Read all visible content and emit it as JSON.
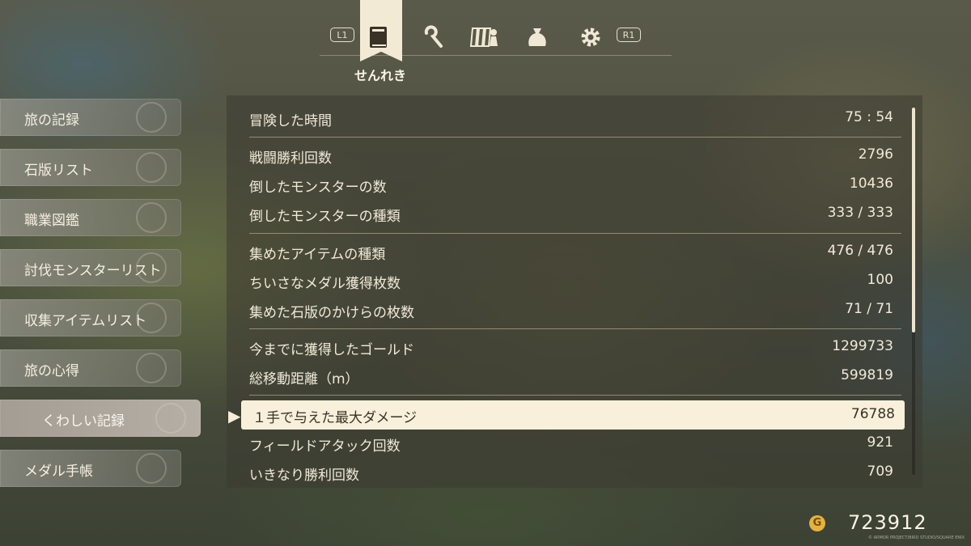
{
  "topnav": {
    "l_button": "L1",
    "r_button": "R1",
    "active_tab_label": "せんれき",
    "icons": [
      "book-icon",
      "staff-icon",
      "party-icon",
      "bag-icon",
      "gear-icon"
    ]
  },
  "sidebar": {
    "items": [
      {
        "label": "旅の記録",
        "icon": "book-icon"
      },
      {
        "label": "石版リスト",
        "icon": "tablet-icon"
      },
      {
        "label": "職業図鑑",
        "icon": "tools-icon"
      },
      {
        "label": "討伐モンスターリスト",
        "icon": "monster-icon"
      },
      {
        "label": "収集アイテムリスト",
        "icon": "bag-icon"
      },
      {
        "label": "旅の心得",
        "icon": "scroll-icon"
      },
      {
        "label": "くわしい記録",
        "icon": "quill-icon"
      },
      {
        "label": "メダル手帳",
        "icon": "medal-icon"
      }
    ]
  },
  "records": [
    {
      "label": "冒険した時間",
      "value": "75 : 54"
    },
    {
      "label": "戦闘勝利回数",
      "value": "2796"
    },
    {
      "label": "倒したモンスターの数",
      "value": "10436"
    },
    {
      "label": "倒したモンスターの種類",
      "value": "333 / 333"
    },
    {
      "label": "集めたアイテムの種類",
      "value": "476 / 476"
    },
    {
      "label": "ちいさなメダル獲得枚数",
      "value": "100"
    },
    {
      "label": "集めた石版のかけらの枚数",
      "value": "71 / 71"
    },
    {
      "label": "今までに獲得したゴールド",
      "value": "1299733"
    },
    {
      "label": "総移動距離（m）",
      "value": "599819"
    },
    {
      "label": "１手で与えた最大ダメージ",
      "value": "76788"
    },
    {
      "label": "フィールドアタック回数",
      "value": "921"
    },
    {
      "label": "いきなり勝利回数",
      "value": "709"
    }
  ],
  "gold": {
    "coin_symbol": "G",
    "value": "723912"
  },
  "copyright": "© ARMOR PROJECT/BIRD STUDIO/SQUARE ENIX",
  "colors": {
    "highlight": "#f8f0da",
    "coin": "#e4b240"
  }
}
